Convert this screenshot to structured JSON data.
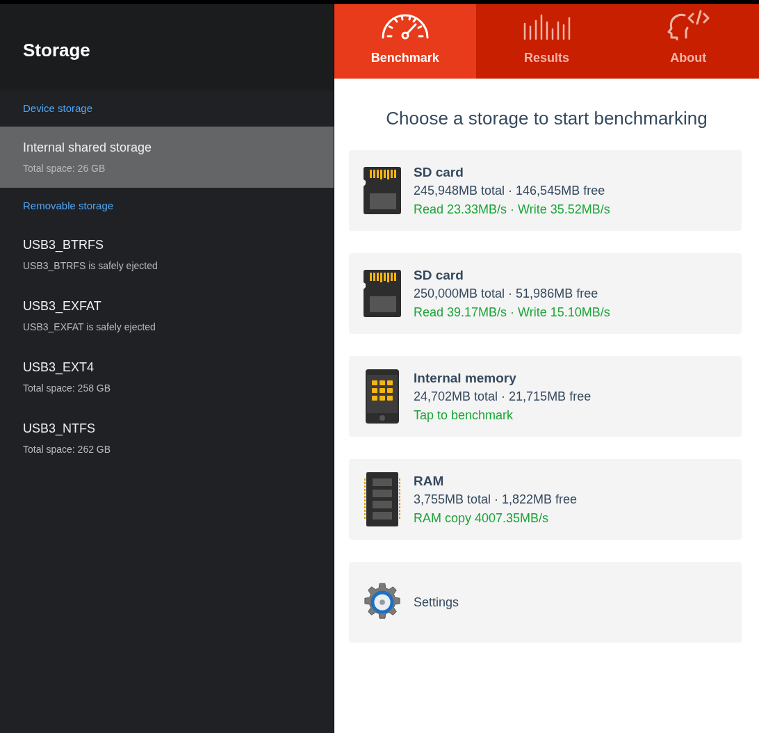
{
  "sidebar": {
    "title": "Storage",
    "items": [
      {
        "kind": "header",
        "label": "Device storage"
      },
      {
        "kind": "item",
        "label": "Internal shared storage",
        "detail": "Total space: 26 GB",
        "selected": true
      },
      {
        "kind": "header",
        "label": "Removable storage"
      },
      {
        "kind": "item",
        "label": "USB3_BTRFS",
        "detail": "USB3_BTRFS is safely ejected",
        "selected": false
      },
      {
        "kind": "item",
        "label": "USB3_EXFAT",
        "detail": "USB3_EXFAT is safely ejected",
        "selected": false
      },
      {
        "kind": "item",
        "label": "USB3_EXT4",
        "detail": "Total space: 258 GB",
        "selected": false
      },
      {
        "kind": "item",
        "label": "USB3_NTFS",
        "detail": "Total space: 262 GB",
        "selected": false
      }
    ]
  },
  "tabs": [
    {
      "label": "Benchmark",
      "kind": "gauge",
      "selected": true
    },
    {
      "label": "Results",
      "kind": "bars",
      "selected": false
    },
    {
      "label": "About",
      "kind": "head",
      "selected": false
    }
  ],
  "heading": "Choose a storage to start benchmarking",
  "cards": [
    {
      "kind": "sd",
      "title": "SD card",
      "info": "245,948MB total · 146,545MB free",
      "status": "Read 23.33MB/s · Write 35.52MB/s"
    },
    {
      "kind": "sd",
      "title": "SD card",
      "info": "250,000MB total · 51,986MB free",
      "status": "Read 39.17MB/s · Write 15.10MB/s"
    },
    {
      "kind": "phone",
      "title": "Internal memory",
      "info": "24,702MB total · 21,715MB free",
      "status": "Tap to benchmark"
    },
    {
      "kind": "ram",
      "title": "RAM",
      "info": "3,755MB total · 1,822MB free",
      "status": "RAM copy 4007.35MB/s"
    },
    {
      "kind": "settings",
      "label": "Settings"
    }
  ]
}
